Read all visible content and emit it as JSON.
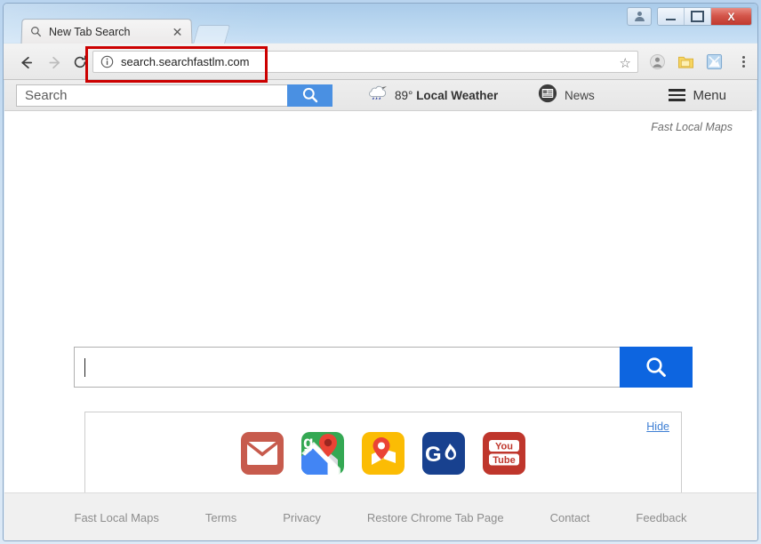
{
  "window": {
    "controls": {
      "user_label": "user-account",
      "minimize_label": "Minimize",
      "maximize_label": "Maximize",
      "close_label": "X"
    }
  },
  "browser": {
    "tab": {
      "title": "New Tab Search",
      "close_label": "✕",
      "favicon": "search-icon"
    },
    "new_tab_button_label": "",
    "nav": {
      "back_label": "←",
      "forward_label": "→",
      "reload_label": "⟳"
    },
    "omnibox": {
      "url": "search.searchfastlm.com",
      "info_icon": "info-circle-icon",
      "star_label": "☆"
    },
    "toolbar_icons": [
      {
        "name": "incognito-person-icon"
      },
      {
        "name": "folder-note-icon"
      },
      {
        "name": "image-placeholder-icon"
      },
      {
        "name": "chrome-menu-icon"
      }
    ],
    "highlight": {
      "color": "#cc0000"
    }
  },
  "extension_bar": {
    "search": {
      "value": "Search",
      "placeholder": "Search",
      "button_icon": "search-icon"
    },
    "weather": {
      "temperature": "89°",
      "label": "Local Weather",
      "icon": "cloud-rain-icon"
    },
    "news": {
      "label": "News",
      "icon": "newspaper-icon"
    },
    "menu": {
      "label": "Menu",
      "icon": "hamburger-icon"
    }
  },
  "page": {
    "brandline": "Fast Local Maps",
    "big_search": {
      "value": "",
      "placeholder": "",
      "button_icon": "search-icon"
    },
    "shortcuts": {
      "hide_label": "Hide",
      "tiles": [
        {
          "name": "gmail",
          "label": "Gmail",
          "color": "#c75b4d"
        },
        {
          "name": "google-maps",
          "label": "Google Maps",
          "color": "#34a853"
        },
        {
          "name": "maps-directions",
          "label": "Maps Directions",
          "color": "#fbbc04"
        },
        {
          "name": "gasbuddy",
          "label": "GasBuddy",
          "color": "#18418f"
        },
        {
          "name": "youtube",
          "label": "YouTube",
          "color": "#bf362c"
        }
      ]
    },
    "footer_links": [
      {
        "label": "Fast Local Maps"
      },
      {
        "label": "Terms"
      },
      {
        "label": "Privacy"
      },
      {
        "label": "Restore Chrome Tab Page"
      },
      {
        "label": "Contact"
      },
      {
        "label": "Feedback"
      }
    ]
  },
  "colors": {
    "accent_blue": "#0d65e0",
    "ext_button_blue": "#4a90e2",
    "highlight_red": "#cc0000",
    "link_blue": "#3e7fd4",
    "footer_text": "#8d8d8d"
  }
}
